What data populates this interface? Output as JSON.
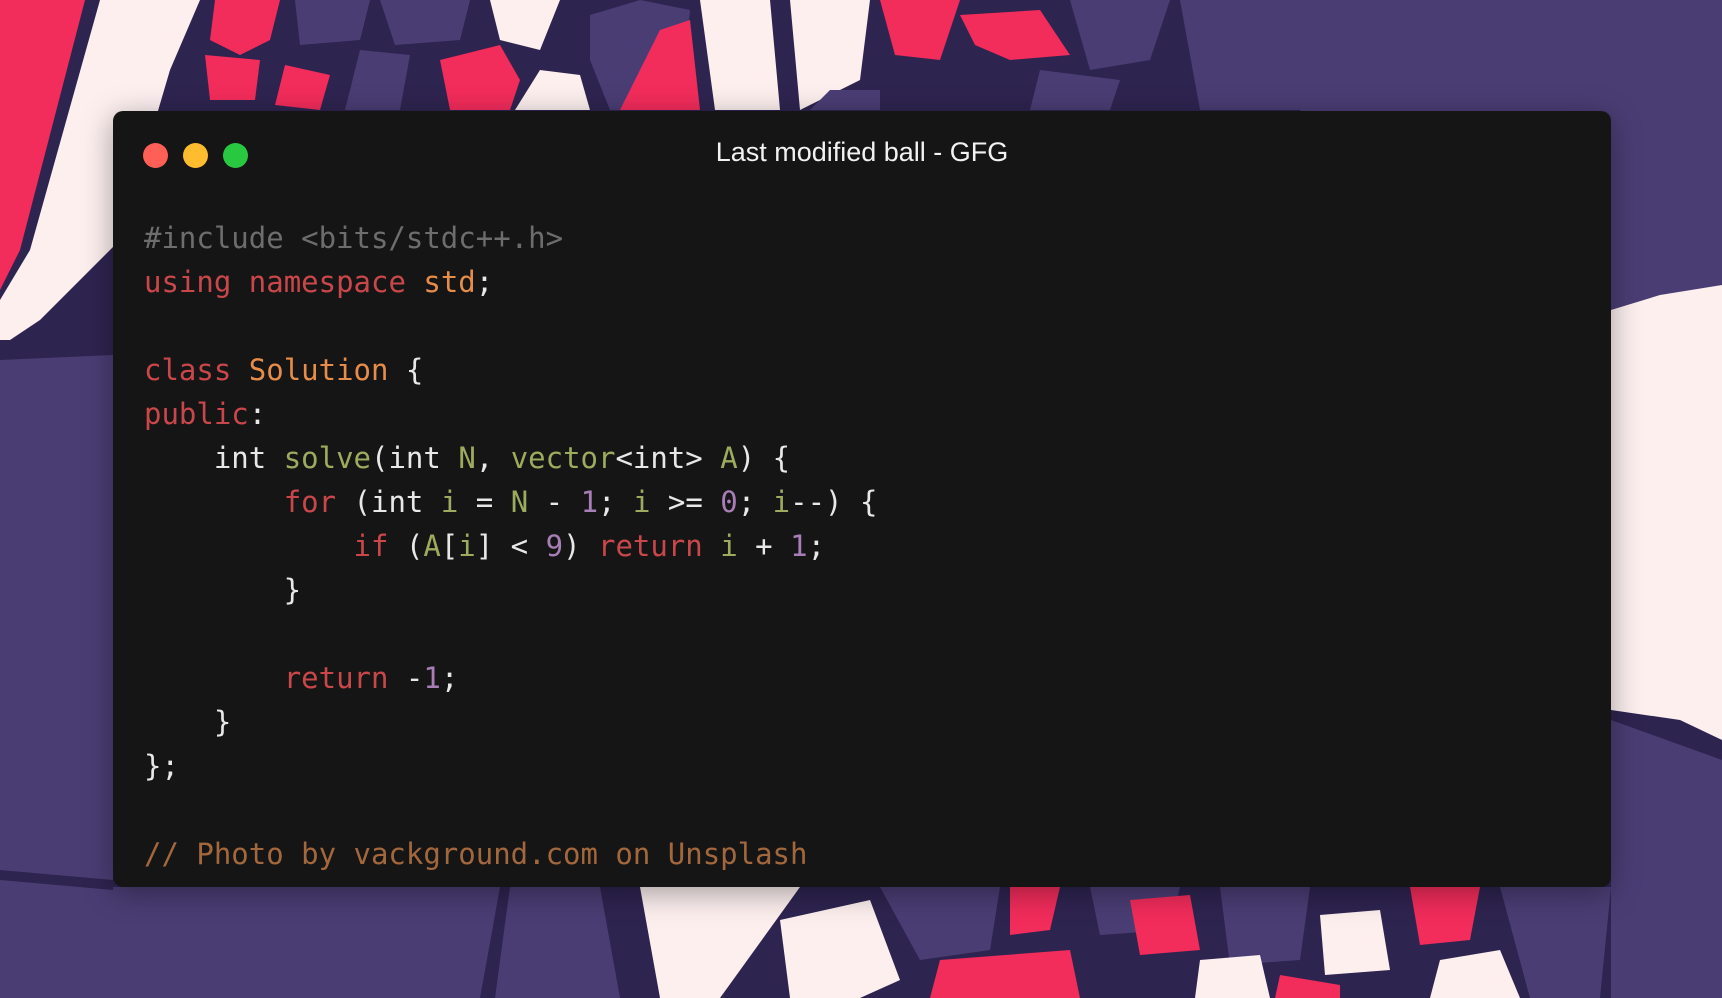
{
  "window": {
    "title": "Last modified ball - GFG",
    "controls": [
      {
        "name": "close",
        "color": "#fe5f57"
      },
      {
        "name": "minimize",
        "color": "#febc2e"
      },
      {
        "name": "maximize",
        "color": "#28c840"
      }
    ]
  },
  "colors": {
    "background_base": "#2e2450",
    "purple": "#4a3d74",
    "pink": "#f22c5b",
    "cream": "#fcefee",
    "window_bg": "#151515",
    "preprocessor": "#6d6d6d",
    "keyword": "#c9474b",
    "type": "#e68d49",
    "function": "#9cab5e",
    "number": "#a77eb6",
    "plain": "#e8e8e8",
    "comment": "#a2673c"
  },
  "code": {
    "lines": [
      [
        {
          "t": "#include <bits/stdc++.h>",
          "c": "pre"
        }
      ],
      [
        {
          "t": "using",
          "c": "kw"
        },
        {
          "t": " "
        },
        {
          "t": "namespace",
          "c": "kw"
        },
        {
          "t": " "
        },
        {
          "t": "std",
          "c": "ty"
        },
        {
          "t": ";"
        }
      ],
      [],
      [
        {
          "t": "class",
          "c": "kw"
        },
        {
          "t": " "
        },
        {
          "t": "Solution",
          "c": "ty"
        },
        {
          "t": " {"
        }
      ],
      [
        {
          "t": "public",
          "c": "kw"
        },
        {
          "t": ":"
        }
      ],
      [
        {
          "t": "    int "
        },
        {
          "t": "solve",
          "c": "fn"
        },
        {
          "t": "(int "
        },
        {
          "t": "N",
          "c": "var"
        },
        {
          "t": ", "
        },
        {
          "t": "vector",
          "c": "fn"
        },
        {
          "t": "<int> "
        },
        {
          "t": "A",
          "c": "var"
        },
        {
          "t": ") {"
        }
      ],
      [
        {
          "t": "        "
        },
        {
          "t": "for",
          "c": "kw"
        },
        {
          "t": " (int "
        },
        {
          "t": "i",
          "c": "var"
        },
        {
          "t": " = "
        },
        {
          "t": "N",
          "c": "var"
        },
        {
          "t": " - "
        },
        {
          "t": "1",
          "c": "num"
        },
        {
          "t": "; "
        },
        {
          "t": "i",
          "c": "var"
        },
        {
          "t": " >= "
        },
        {
          "t": "0",
          "c": "num"
        },
        {
          "t": "; "
        },
        {
          "t": "i",
          "c": "var"
        },
        {
          "t": "--) {"
        }
      ],
      [
        {
          "t": "            "
        },
        {
          "t": "if",
          "c": "kw"
        },
        {
          "t": " ("
        },
        {
          "t": "A",
          "c": "var"
        },
        {
          "t": "["
        },
        {
          "t": "i",
          "c": "var"
        },
        {
          "t": "] < "
        },
        {
          "t": "9",
          "c": "num"
        },
        {
          "t": ") "
        },
        {
          "t": "return",
          "c": "kw"
        },
        {
          "t": " "
        },
        {
          "t": "i",
          "c": "var"
        },
        {
          "t": " + "
        },
        {
          "t": "1",
          "c": "num"
        },
        {
          "t": ";"
        }
      ],
      [
        {
          "t": "        }"
        }
      ],
      [],
      [
        {
          "t": "        "
        },
        {
          "t": "return",
          "c": "kw"
        },
        {
          "t": " -"
        },
        {
          "t": "1",
          "c": "num"
        },
        {
          "t": ";"
        }
      ],
      [
        {
          "t": "    }"
        }
      ],
      [
        {
          "t": "};"
        }
      ],
      [],
      [
        {
          "t": "// Photo by vackground.com on Unsplash",
          "c": "cm"
        }
      ]
    ]
  }
}
